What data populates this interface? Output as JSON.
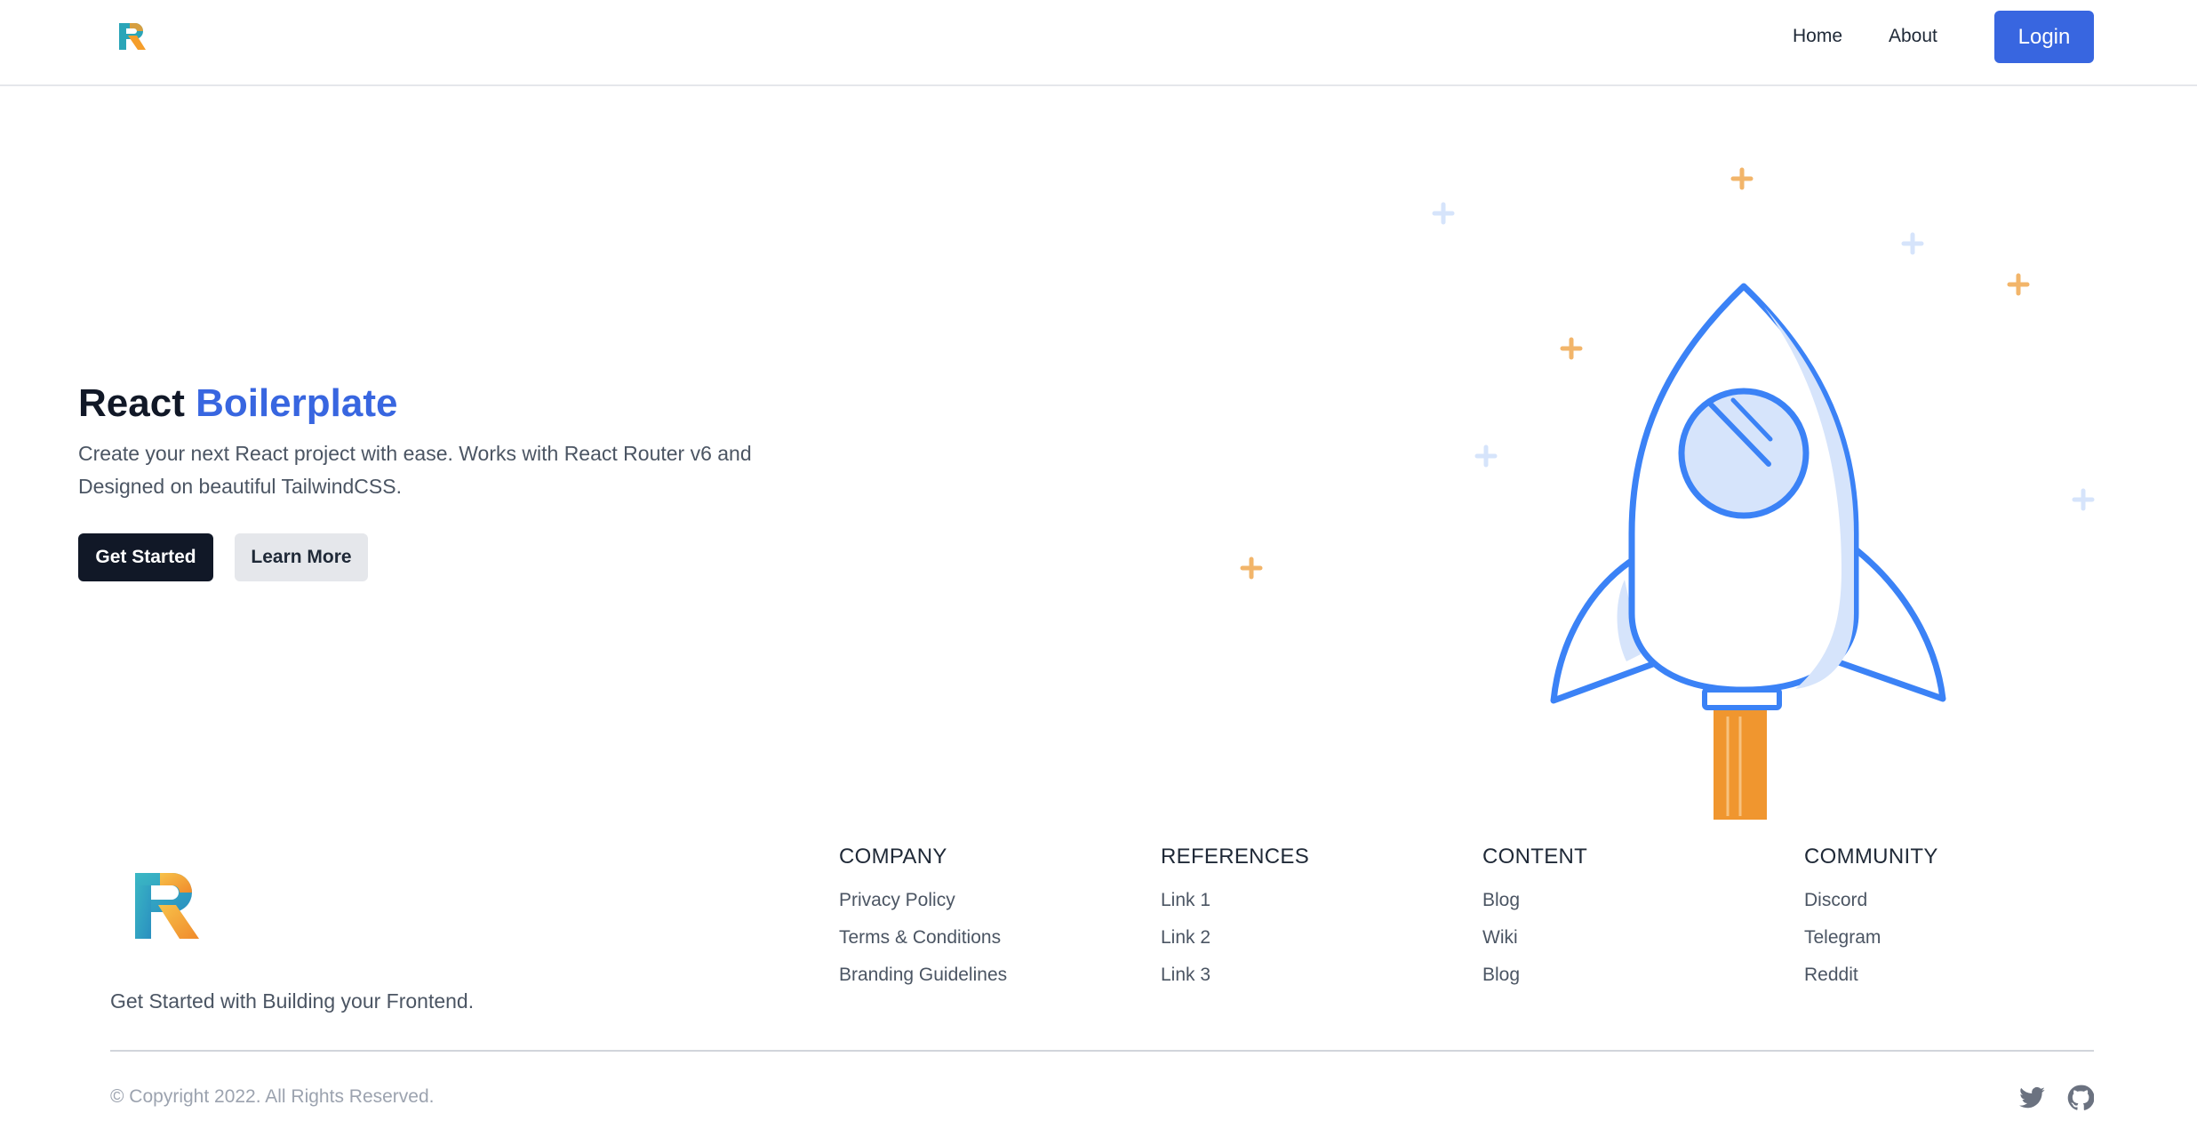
{
  "nav": {
    "logo_letter": "R",
    "home": "Home",
    "about": "About",
    "login": "Login"
  },
  "hero": {
    "title_plain": "React",
    "title_accent": "Boilerplate",
    "description": "Create your next React project with ease. Works with React Router v6 and Designed on beautiful TailwindCSS.",
    "primary_button": "Get Started",
    "secondary_button": "Learn More"
  },
  "footer": {
    "tagline": "Get Started with Building your Frontend.",
    "columns": [
      {
        "heading": "COMPANY",
        "links": [
          "Privacy Policy",
          "Terms & Conditions",
          "Branding Guidelines"
        ]
      },
      {
        "heading": "REFERENCES",
        "links": [
          "Link 1",
          "Link 2",
          "Link 3"
        ]
      },
      {
        "heading": "CONTENT",
        "links": [
          "Blog",
          "Wiki",
          "Blog"
        ]
      },
      {
        "heading": "COMMUNITY",
        "links": [
          "Discord",
          "Telegram",
          "Reddit"
        ]
      }
    ],
    "copyright": "© Copyright 2022. All Rights Reserved.",
    "social_icons": [
      "twitter-icon",
      "github-icon"
    ]
  },
  "colors": {
    "accent": "#3866e0",
    "dark": "#111827",
    "rocket_blue": "#3b82f6",
    "rocket_flame": "#f0962f",
    "logo_teal": "#2aa5b8",
    "logo_orange": "#f59e2b"
  }
}
